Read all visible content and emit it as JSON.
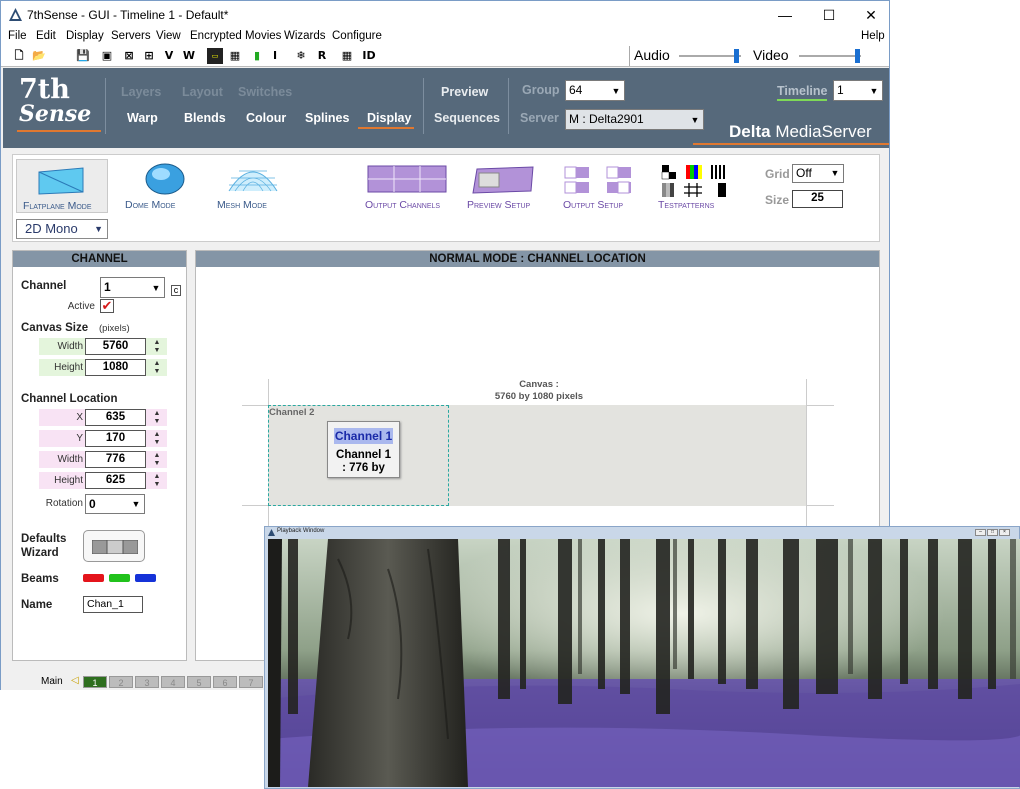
{
  "titlebar": {
    "title": "7thSense -   GUI  - Timeline 1  - Default*",
    "minimize": "—",
    "maximize": "☐",
    "close": "✕"
  },
  "menu": {
    "items": [
      "File",
      "Edit",
      "Display",
      "Servers",
      "View",
      "Encrypted Movies",
      "Wizards",
      "Configure"
    ],
    "help": "Help"
  },
  "toolbar": {
    "audio_label": "Audio",
    "video_label": "Video",
    "buttons": [
      "V",
      "W",
      "I",
      "R",
      "ID"
    ]
  },
  "logo": {
    "line1": "7th",
    "line2": "Sense"
  },
  "nav": {
    "top_row": [
      "Layers",
      "Layout",
      "Switches"
    ],
    "bottom_row": [
      "Warp",
      "Blends",
      "Colour",
      "Splines",
      "Display"
    ],
    "active": "Display",
    "preview": "Preview",
    "sequences": "Sequences",
    "group_label": "Group",
    "group_value": "64",
    "server_label": "Server",
    "server_value": "M : Delta2901",
    "timeline_label": "Timeline",
    "timeline_value": "1",
    "brand_bold": "Delta",
    "brand_rest": "MediaServer"
  },
  "modes": {
    "flatplane": "Flatplane Mode",
    "dome": "Dome Mode",
    "mesh": "Mesh Mode",
    "stereo_value": "2D Mono",
    "output_channels": "Output Channels",
    "preview_setup": "Preview Setup",
    "output_setup": "Output Setup",
    "testpatterns": "Testpatterns",
    "grid_label": "Grid",
    "grid_value": "Off",
    "size_label": "Size",
    "size_value": "25"
  },
  "channel_panel": {
    "header": "CHANNEL",
    "channel_label": "Channel",
    "channel_value": "1",
    "copy_button": "c",
    "active_label": "Active",
    "canvas_size_label": "Canvas Size",
    "canvas_size_unit": "(pixels)",
    "width_label": "Width",
    "width_value": "5760",
    "height_label": "Height",
    "height_value": "1080",
    "location_label": "Channel Location",
    "x_label": "X",
    "x_value": "635",
    "y_label": "Y",
    "y_value": "170",
    "loc_width_label": "Width",
    "loc_width_value": "776",
    "loc_height_label": "Height",
    "loc_height_value": "625",
    "rotation_label": "Rotation",
    "rotation_value": "0",
    "defaults_wizard_label": "Defaults\nWizard",
    "beams_label": "Beams",
    "beam_colors": [
      "#e4141b",
      "#21c21c",
      "#1532d8"
    ],
    "name_label": "Name",
    "name_value": "Chan_1"
  },
  "canvas_panel": {
    "header": "NORMAL MODE : CHANNEL LOCATION",
    "canvas_title": "Canvas :",
    "canvas_size": "5760 by 1080 pixels",
    "channel_overlay": "Channel 2",
    "popup_title": "Channel 1",
    "popup_line1": "Channel 1",
    "popup_line2": ": 776 by"
  },
  "statusbar": {
    "main_label": "Main",
    "tabs": [
      "1",
      "2",
      "3",
      "4",
      "5",
      "6",
      "7"
    ],
    "active_tab": "1"
  },
  "playback": {
    "title": "Playback Window"
  },
  "colors": {
    "banner": "#56697b",
    "accent_orange": "#e07830",
    "timeline_green": "#7ed957",
    "mode_purple": "#6b4aa6"
  }
}
